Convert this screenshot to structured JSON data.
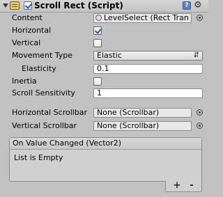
{
  "header": {
    "title": "Scroll Rect (Script)",
    "enabled": true,
    "help_icon": "help-icon",
    "settings_icon": "gear-icon"
  },
  "fields": {
    "content": {
      "label": "Content",
      "value": "LevelSelect (Rect Tran"
    },
    "horizontal": {
      "label": "Horizontal",
      "checked": true
    },
    "vertical": {
      "label": "Vertical",
      "checked": false
    },
    "movement_type": {
      "label": "Movement Type",
      "value": "Elastic"
    },
    "elasticity": {
      "label": "Elasticity",
      "value": "0.1"
    },
    "inertia": {
      "label": "Inertia",
      "checked": false
    },
    "scroll_sensitivity": {
      "label": "Scroll Sensitivity",
      "value": "1"
    },
    "horizontal_scrollbar": {
      "label": "Horizontal Scrollbar",
      "value": "None (Scrollbar)"
    },
    "vertical_scrollbar": {
      "label": "Vertical Scrollbar",
      "value": "None (Scrollbar)"
    }
  },
  "event": {
    "header": "On Value Changed (Vector2)",
    "empty_text": "List is Empty",
    "add_label": "+",
    "remove_label": "-"
  },
  "colors": {
    "panel_bg": "#c2c2c2",
    "checkmark": "#2e55a8"
  }
}
